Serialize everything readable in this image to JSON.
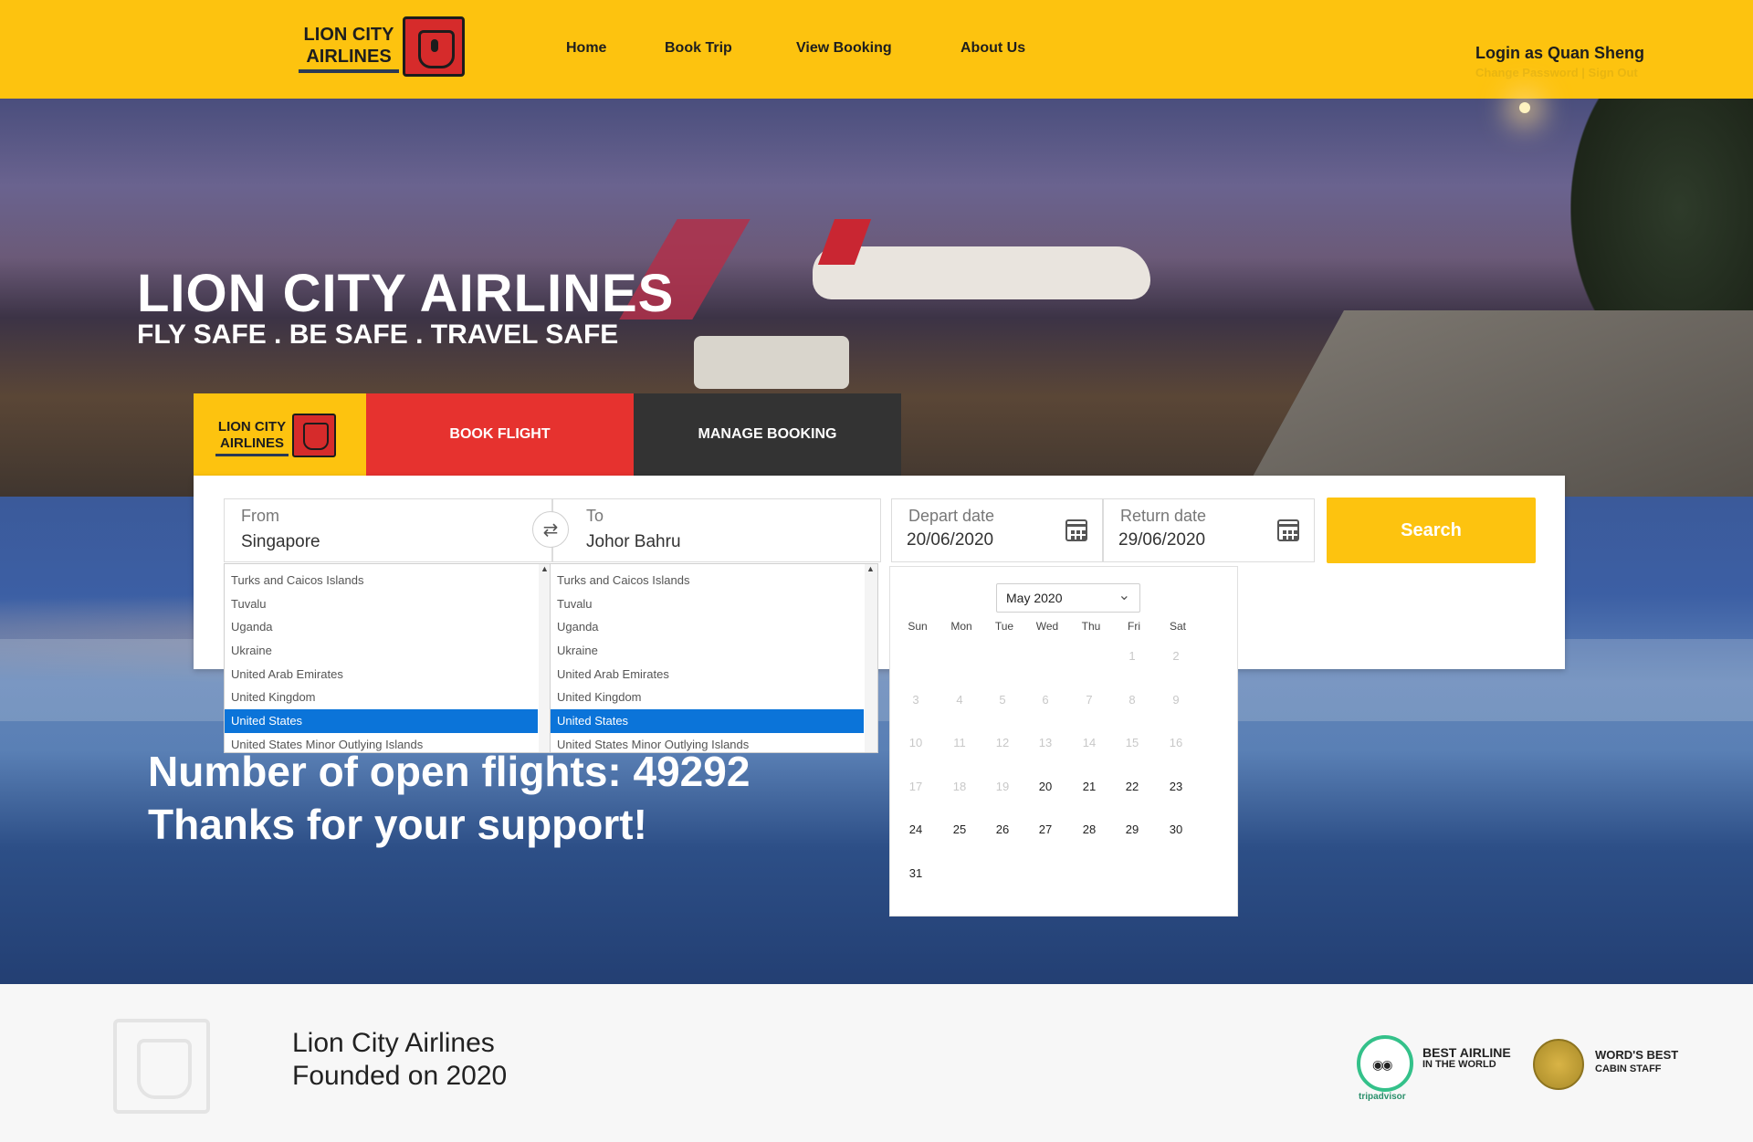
{
  "header": {
    "logo_text": "LION CITY AIRLINES",
    "nav": [
      "Home",
      "Book Trip",
      "View Booking",
      "About Us"
    ],
    "login_label": "Login as Quan Sheng",
    "login_links": "Change Password | Sign Out"
  },
  "hero": {
    "title": "LION CITY AIRLINES",
    "subtitle": "FLY SAFE . BE SAFE . TRAVEL SAFE",
    "open_flights": "Number of open flights: 49292",
    "thanks": "Thanks for your support!"
  },
  "tabs": {
    "logo_text": "LION CITY AIRLINES",
    "book": "BOOK FLIGHT",
    "manage": "MANAGE BOOKING"
  },
  "search": {
    "from_label": "From",
    "from_value": "Singapore",
    "to_label": "To",
    "to_value": "Johor Bahru",
    "swap_icon": "swap-arrows-icon",
    "depart_label": "Depart date",
    "depart_value": "20/06/2020",
    "return_label": "Return date",
    "return_value": "29/06/2020",
    "search_label": "Search"
  },
  "country_list": {
    "items": [
      "Turks and Caicos Islands",
      "Tuvalu",
      "Uganda",
      "Ukraine",
      "United Arab Emirates",
      "United Kingdom",
      "United States",
      "United States Minor Outlying Islands"
    ],
    "selected": "United States"
  },
  "calendar": {
    "month": "May 2020",
    "weekdays": [
      "Sun",
      "Mon",
      "Tue",
      "Wed",
      "Thu",
      "Fri",
      "Sat"
    ],
    "weeks": [
      [
        "",
        "",
        "",
        "",
        "",
        "1",
        "2"
      ],
      [
        "3",
        "4",
        "5",
        "6",
        "7",
        "8",
        "9"
      ],
      [
        "10",
        "11",
        "12",
        "13",
        "14",
        "15",
        "16"
      ],
      [
        "17",
        "18",
        "19",
        "20",
        "21",
        "22",
        "23"
      ],
      [
        "24",
        "25",
        "26",
        "27",
        "28",
        "29",
        "30"
      ],
      [
        "31",
        "",
        "",
        "",
        "",
        "",
        ""
      ]
    ],
    "first_enabled_day": 20
  },
  "footer": {
    "company": "Lion City Airlines",
    "founded": "Founded on 2020",
    "award1_line1": "BEST AIRLINE",
    "award1_line2": "IN THE WORLD",
    "award1_brand": "tripadvisor",
    "award2_line1": "WORD'S BEST",
    "award2_line2": "CABIN STAFF"
  },
  "colors": {
    "brand_yellow": "#fdc30f",
    "book_red": "#e6322f",
    "manage_dark": "#333333",
    "selection_blue": "#0b74d9"
  }
}
